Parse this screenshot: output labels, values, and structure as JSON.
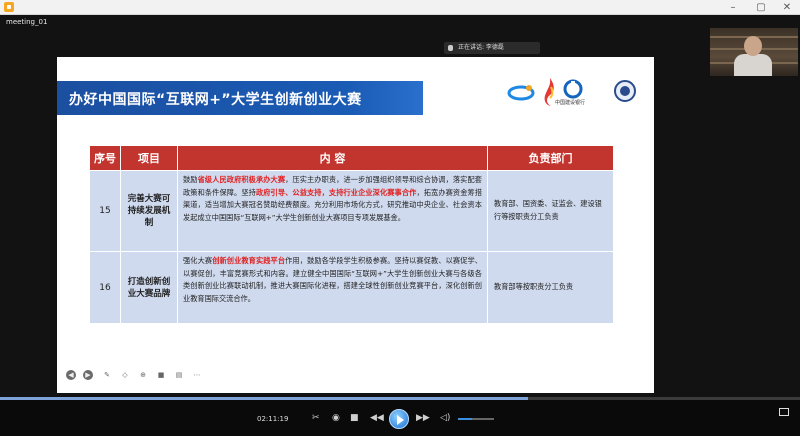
{
  "window": {
    "title_icon": "app-icon",
    "meeting_name": "meeting_01",
    "controls": [
      "minimize",
      "maximize",
      "close"
    ]
  },
  "speaker_tag": "正在讲话: 李德磊",
  "slide": {
    "title": "办好中国国际“互联网+”大学生创新创业大赛",
    "logos": [
      "competition-logo",
      "flame-logo",
      "China Construction Bank",
      "university-seal"
    ],
    "logo_text_ccb": "中国建设银行",
    "table": {
      "headers": [
        "序号",
        "项目",
        "内 容",
        "负责部门"
      ],
      "rows": [
        {
          "num": "15",
          "project": "完善大赛可持续发展机制",
          "content_parts": [
            {
              "text": "鼓励",
              "red": false
            },
            {
              "text": "省级人民政府积极承办大赛",
              "red": true
            },
            {
              "text": "，压实主办职责，进一步加强组织领导和综合协调，落实配套政策和条件保障。坚持",
              "red": false
            },
            {
              "text": "政府引导、公益支持，支持行业企业深化赛事合作",
              "red": true
            },
            {
              "text": "，拓宽办赛资金筹措渠道，适当增加大赛冠名赞助经费额度。充分利用市场化方式，研究推动中央企业、社会资本发起成立中国国际“互联网+”大学生创新创业大赛项目专项发展基金。",
              "red": false
            }
          ],
          "dept": "教育部、国资委、证监会、建设银行等按职责分工负责"
        },
        {
          "num": "16",
          "project": "打造创新创业大赛品牌",
          "content_parts": [
            {
              "text": "强化大赛",
              "red": false
            },
            {
              "text": "创新创业教育实践平台",
              "red": true
            },
            {
              "text": "作用，鼓励各学段学生积极参赛。坚持以赛促教、以赛促学、以赛促创，丰富竞赛形式和内容。建立健全中国国际“互联网+”大学生创新创业大赛与各级各类创新创业比赛联动机制，推进大赛国际化进程，搭建全球性创新创业竞赛平台，深化创新创业教育国际交流合作。",
              "red": false
            }
          ],
          "dept": "教育部等按职责分工负责"
        }
      ]
    },
    "tools": [
      "prev-icon",
      "next-icon",
      "pen-icon",
      "eraser-icon",
      "target-icon",
      "camera-icon",
      "caption-icon",
      "more-icon"
    ]
  },
  "player": {
    "time": "02:11:19",
    "progress": 0.66,
    "volume": 0.4,
    "colors": {
      "accent": "#1a6fd1",
      "banner": "#1b4fa0",
      "header_red": "#c2352f",
      "cell_blue": "#cfdaee"
    }
  }
}
